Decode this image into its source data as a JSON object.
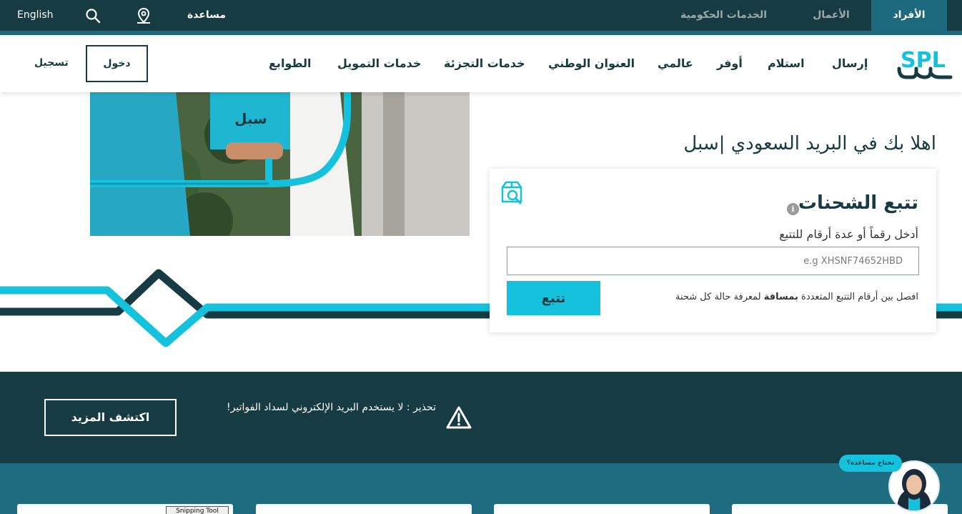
{
  "topbar": {
    "tabs": [
      {
        "label": "الأفراد",
        "active": true
      },
      {
        "label": "الأعمال",
        "active": false
      },
      {
        "label": "الخدمات الحكومية",
        "active": false
      }
    ],
    "help_label": "مساعدة",
    "language_label": "English"
  },
  "nav": {
    "logo_text": "SPL",
    "items": [
      "إرسال",
      "استلام",
      "أوفر",
      "عالمي",
      "العنوان الوطني",
      "خدمات التجزئة",
      "خدمات التمويل",
      "الطوابع"
    ],
    "login_label": "دخول",
    "register_label": "تسجيل"
  },
  "hero": {
    "welcome": "اهلا بك في البريد السعودي |سبل",
    "box_text": "سبل"
  },
  "tracking": {
    "title": "تتبع الشحنات",
    "subtitle": "أدخل رقماً أو عدة أرقام للتتبع",
    "placeholder": "e.g XHSNF74652HBD",
    "button_label": "تتبع",
    "hint_pre": "افصل بين أرقام التتبع المتعددة ",
    "hint_bold": "بمسافة",
    "hint_post": " لمعرفة حالة كل شحنة",
    "info_glyph": "i"
  },
  "warning": {
    "text": "تحذير : لا يستخدم البريد الإلكتروني لسداد الفواتير!",
    "button_label": "اكتشف المزيد"
  },
  "snipping_label": "Snipping Tool",
  "chat": {
    "bubble": "تحتاج مساعدة؟"
  },
  "colors": {
    "dark_teal": "#163b42",
    "mid_teal": "#1d6a7e",
    "cyan": "#14c2dd"
  }
}
